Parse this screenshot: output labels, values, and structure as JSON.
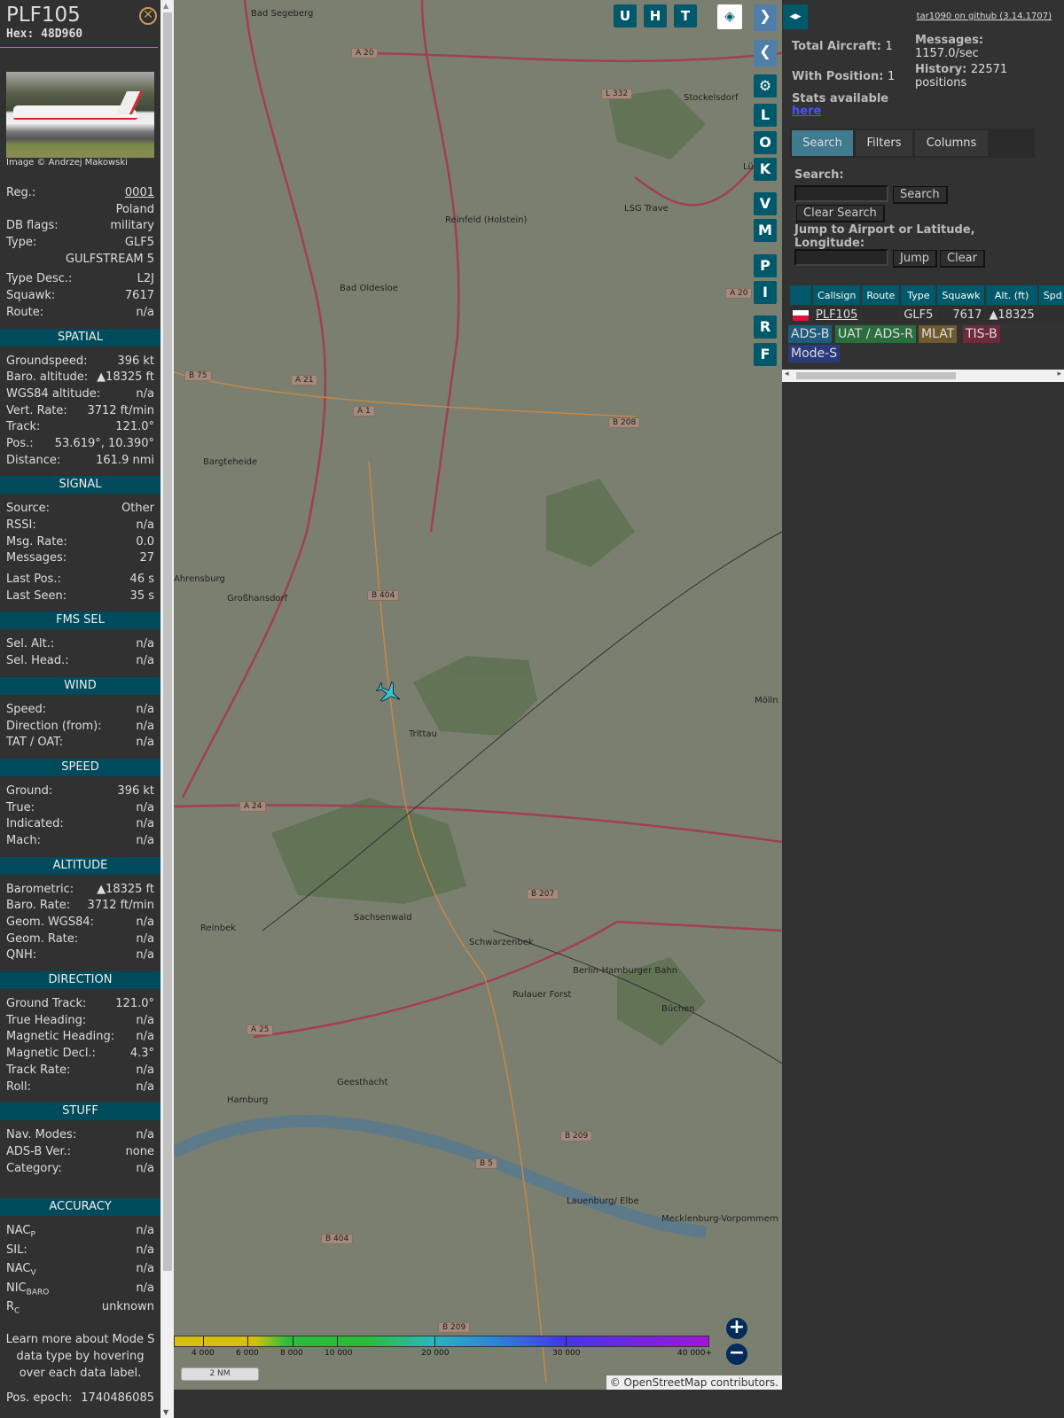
{
  "aircraft": {
    "callsign": "PLF105",
    "hex_label": "Hex: 48D960",
    "image_credit": "Image © Andrzej Makowski"
  },
  "info_rows": [
    {
      "label": "Reg.:",
      "value": "0001",
      "link": true
    },
    {
      "label": "",
      "value": "Poland"
    },
    {
      "label": "DB flags:",
      "value": "military"
    },
    {
      "label": "Type:",
      "value": "GLF5"
    },
    {
      "label": "",
      "value": "GULFSTREAM 5"
    },
    {
      "label": "Type Desc.:",
      "value": "L2J"
    },
    {
      "label": "Squawk:",
      "value": "7617"
    },
    {
      "label": "Route:",
      "value": "n/a"
    }
  ],
  "sections": [
    {
      "title": "SPATIAL",
      "rows": [
        [
          "Groundspeed:",
          "396 kt"
        ],
        [
          "Baro. altitude:",
          "▲18325 ft"
        ],
        [
          "WGS84 altitude:",
          "n/a"
        ],
        [
          "Vert. Rate:",
          "3712 ft/min"
        ],
        [
          "Track:",
          "121.0°"
        ],
        [
          "Pos.:",
          "53.619°, 10.390°"
        ],
        [
          "Distance:",
          "161.9 nmi"
        ]
      ]
    },
    {
      "title": "SIGNAL",
      "rows": [
        [
          "Source:",
          "Other"
        ],
        [
          "RSSI:",
          "n/a"
        ],
        [
          "Msg. Rate:",
          "0.0"
        ],
        [
          "Messages:",
          "27"
        ],
        [
          "Last Pos.:",
          "46 s"
        ],
        [
          "Last Seen:",
          "35 s"
        ]
      ]
    },
    {
      "title": "FMS SEL",
      "rows": [
        [
          "Sel. Alt.:",
          "n/a"
        ],
        [
          "Sel. Head.:",
          "n/a"
        ]
      ]
    },
    {
      "title": "WIND",
      "rows": [
        [
          "Speed:",
          "n/a"
        ],
        [
          "Direction (from):",
          "n/a"
        ],
        [
          "TAT / OAT:",
          "n/a"
        ]
      ]
    },
    {
      "title": "SPEED",
      "rows": [
        [
          "Ground:",
          "396 kt"
        ],
        [
          "True:",
          "n/a"
        ],
        [
          "Indicated:",
          "n/a"
        ],
        [
          "Mach:",
          "n/a"
        ]
      ]
    },
    {
      "title": "ALTITUDE",
      "rows": [
        [
          "Barometric:",
          "▲18325 ft"
        ],
        [
          "Baro. Rate:",
          "3712 ft/min"
        ],
        [
          "Geom. WGS84:",
          "n/a"
        ],
        [
          "Geom. Rate:",
          "n/a"
        ],
        [
          "QNH:",
          "n/a"
        ]
      ]
    },
    {
      "title": "DIRECTION",
      "rows": [
        [
          "Ground Track:",
          "121.0°"
        ],
        [
          "True Heading:",
          "n/a"
        ],
        [
          "Magnetic Heading:",
          "n/a"
        ],
        [
          "Magnetic Decl.:",
          "4.3°"
        ],
        [
          "Track Rate:",
          "n/a"
        ],
        [
          "Roll:",
          "n/a"
        ]
      ]
    },
    {
      "title": "STUFF",
      "rows": [
        [
          "Nav. Modes:",
          "n/a"
        ],
        [
          "ADS-B Ver.:",
          "none"
        ],
        [
          "Category:",
          "n/a"
        ]
      ]
    }
  ],
  "accuracy": {
    "title": "ACCURACY",
    "rows": [
      {
        "label": "NAC",
        "sub": "P",
        "value": "n/a"
      },
      {
        "label": "SIL:",
        "sub": "",
        "value": "n/a"
      },
      {
        "label": "NAC",
        "sub": "V",
        "value": "n/a"
      },
      {
        "label": "NIC",
        "sub": "BARO",
        "value": "n/a"
      },
      {
        "label": "R",
        "sub": "C",
        "value": "unknown"
      }
    ]
  },
  "learn_more": "Learn more about Mode S data type by hovering over each data label.",
  "pos_epoch": {
    "label": "Pos. epoch:",
    "value": "1740486085"
  },
  "map": {
    "top_buttons": [
      "U",
      "H",
      "T"
    ],
    "side_buttons": [
      "L",
      "O",
      "K",
      "V",
      "M",
      "P",
      "I",
      "R",
      "F"
    ],
    "towns": [
      "Bad Segeberg",
      "Stockelsdorf",
      "Reinfeld (Holstein)",
      "Bad Oldesloe",
      "Bargteheide",
      "Ahrensburg",
      "Großhansdorf",
      "Trittau",
      "Mölln",
      "Reinbek",
      "Sachsenwald",
      "Schwarzenbek",
      "Rulauer Forst",
      "Büchen",
      "Geesthacht",
      "Lauenburg/ Elbe",
      "Hamburg",
      "Berlin-Hamburger Bahn",
      "LSG Trave",
      "Mecklenburg-Vorpommern",
      "Lübeck"
    ],
    "roads": [
      "A 20",
      "L 332",
      "A 20",
      "B 75",
      "A 21",
      "A 1",
      "B 208",
      "B 404",
      "A 24",
      "B 207",
      "A 25",
      "B 209",
      "B 5",
      "B 404",
      "B 209"
    ],
    "color_scale_labels": [
      "4 000",
      "6 000",
      "8 000",
      "10 000",
      "20 000",
      "30 000",
      "40 000+"
    ],
    "scale_bar": "2 NM",
    "attribution_prefix": "©",
    "attribution_link": "OpenStreetMap",
    "attribution_suffix": "contributors.",
    "zoom_in": "+",
    "zoom_out": "−"
  },
  "right": {
    "github": "tar1090 on github (3.14.1707)",
    "total_aircraft_label": "Total Aircraft:",
    "total_aircraft": "1",
    "with_position_label": "With Position:",
    "with_position": "1",
    "messages_label": "Messages:",
    "messages": "1157.0/sec",
    "history_label": "History:",
    "history": "22571 positions",
    "stats_label": "Stats available",
    "stats_link": "here",
    "tabs": [
      "Search",
      "Filters",
      "Columns"
    ],
    "search_label": "Search:",
    "search_value": "",
    "search_button": "Search",
    "clear_search": "Clear Search",
    "jump_label": "Jump to Airport or Latitude, Longitude:",
    "jump_value": "",
    "jump_button": "Jump",
    "clear_button": "Clear",
    "columns": [
      "Callsign",
      "Route",
      "Type",
      "Squawk",
      "Alt. (ft)",
      "Spd"
    ],
    "rows": [
      {
        "callsign": "PLF105",
        "route": "",
        "type": "GLF5",
        "squawk": "7617",
        "alt": "▲18325",
        "spd": ""
      }
    ],
    "sources": [
      {
        "label": "ADS-B",
        "color": "#1f5b7a"
      },
      {
        "label": "UAT / ADS-R",
        "color": "#2a6e3e"
      },
      {
        "label": "MLAT",
        "color": "#6e5a2e"
      },
      {
        "label": "TIS-B",
        "color": "#6e2a3a"
      },
      {
        "label": "Mode-S",
        "color": "#2a3a7a"
      }
    ]
  }
}
